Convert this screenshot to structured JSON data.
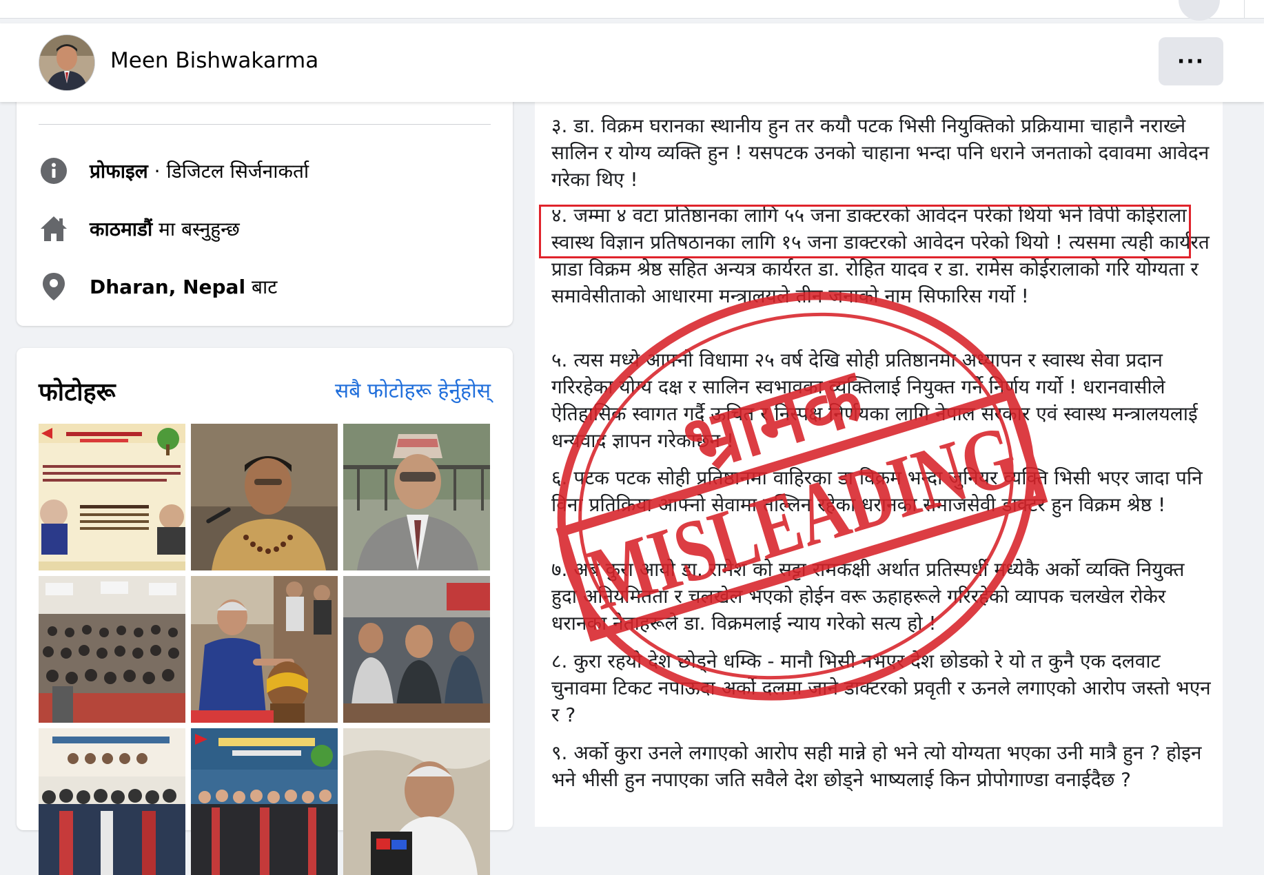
{
  "profile": {
    "name": "Meen Bishwakarma",
    "more_label": "···"
  },
  "intro": {
    "rows": [
      {
        "bold": "प्रोफाइल",
        "rest": " · डिजिटल सिर्जनाकर्ता",
        "icon": "info-icon"
      },
      {
        "bold": "काठमाडौं",
        "rest": " मा बस्नुहुन्छ",
        "icon": "home-icon"
      },
      {
        "bold": "Dharan, Nepal",
        "rest": " बाट",
        "icon": "location-pin-icon"
      }
    ]
  },
  "photos": {
    "title": "फोटोहरू",
    "see_all": "सबै फोटोहरू हेर्नुहोस्"
  },
  "post": {
    "paragraphs": [
      "३. डा. विक्रम घरानका स्थानीय हुन तर कयौ पटक भिसी नियुक्तिको प्रक्रियामा चाहानै नराख्ने सालिन र योग्य व्यक्ति हुन ! यसपटक उनको चाहाना भन्दा पनि धराने जनताको दवावमा आवेदन गरेका थिए !",
      "४. जम्मा ४ वटा प्रतिष्ठानका लागि ५५ जना डाक्टरको आवेदन परेको थियो भने विपी कोईराला स्वास्थ विज्ञान प्रतिषठानका लागि १५ जना डाक्टरको आवेदन परेको थियो ! त्यसमा त्यही कार्यरत प्राडा विक्रम श्रेष्ठ सहित अन्यत्र कार्यरत डा. रोहित यादव र डा. रामेस कोईरालाको गरि योग्यता र समावेसीताको आधारमा मन्त्रालयले तीन जनाको नाम सिफारिस गर्यो !",
      "५. त्यस मध्ये आफ्नो विधामा २५ वर्ष देखि सोही प्रतिष्ठानमा अध्यापन र स्वास्थ सेवा प्रदान गरिरहेका योग्य दक्ष र सालिन स्वभावका व्यक्तिलाई नियुक्त गर्ने निर्णय गर्यो ! धरानवासीले ऐतिहासिक स्वागत गर्दै ऊचित र निस्पक्ष निर्णयका लागि नेपाल सरकार एवं स्वास्थ मन्त्रालयलाई धन्यवाद ज्ञापन गरेकाछन !",
      "६. पटक पटक सोही प्रतिष्ठानमा वाहिरका डा विक्रम भन्दा जुनियर व्यक्ति भिसी भएर जादा पनि विना प्रतिक्रिया आफ्नो सेवामा तल्लिन रहेका धरानका समाजसेवी डाक्टर हुन विक्रम श्रेष्ठ !",
      "७. अब कुरा आयो डा. रामेश को सट्टा रामकक्षी अर्थात प्रतिस्पर्धी मध्येकै अर्को व्यक्ति नियुक्त हुदा अनियमितता र चलखेल भएको होईन वरू ऊहाहरूले गरिरहेको व्यापक चलखेल रोकेर धरानका नेताहरूले डा. विक्रमलाई न्याय गरेको सत्य हो !",
      "८. कुरा रहयो देश छोड्ने धम्कि - मानौ भिसी नभएर देश छोडको रे यो त कुनै एक दलवाट चुनावमा टिकट नपाऊदा अर्को दलमा जाने डाक्टरको प्रवृती र ऊनले लगाएको आरोप जस्तो भएन र ?",
      "९. अर्को कुरा उनले लगाएको आरोप सही मान्ने हो भने त्यो योग्यता भएका उनी मात्रै हुन ? होइन भने भीसी हुन नपाएका जति सवैले देश छोड्ने भाष्यलाई किन प्रोपोगाण्डा वनाईदैछ ?"
    ]
  },
  "stamp": {
    "top_text": "भ्रामक",
    "main_text": "MISLEADING",
    "color": "#d8232a"
  },
  "colors": {
    "link": "#216fdb",
    "highlight_box": "#e0232b"
  }
}
